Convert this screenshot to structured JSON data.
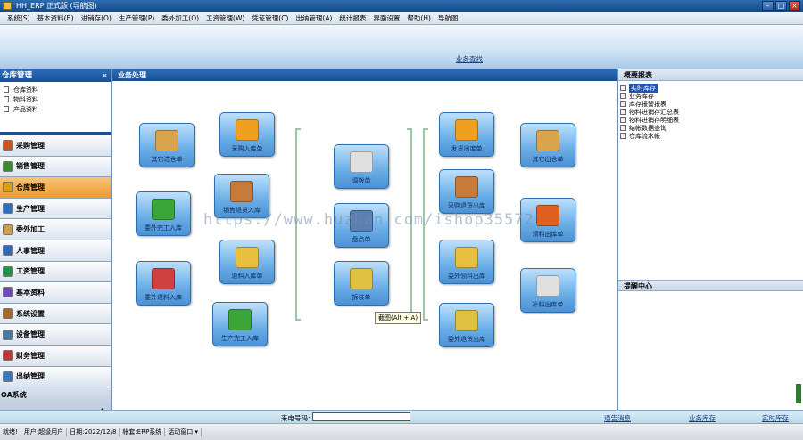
{
  "window": {
    "title": "HH_ERP  正式版  (导航图)",
    "min": "–",
    "max": "□",
    "close": "×"
  },
  "menu": [
    "系统(S)",
    "基本资料(B)",
    "进销存(O)",
    "生产管理(P)",
    "委外加工(O)",
    "工资管理(W)",
    "凭证管理(C)",
    "出纳管理(A)",
    "统计报表",
    "界面设置",
    "帮助(H)",
    "导航图"
  ],
  "banner": {
    "tab": "业务查找"
  },
  "left": {
    "header": "仓库管理",
    "collapse": "«",
    "subitems": [
      "仓库资料",
      "物料资料",
      "产品资料"
    ],
    "nav": [
      {
        "label": "采购管理",
        "color": "#c8551e"
      },
      {
        "label": "销售管理",
        "color": "#3a8a2e"
      },
      {
        "label": "仓库管理",
        "color": "#d4a017"
      },
      {
        "label": "生产管理",
        "color": "#2f6fc0"
      },
      {
        "label": "委外加工",
        "color": "#c7a24a"
      },
      {
        "label": "人事管理",
        "color": "#3467b5"
      },
      {
        "label": "工资管理",
        "color": "#2a8f4e"
      },
      {
        "label": "基本资料",
        "color": "#6b4fb0"
      },
      {
        "label": "系统设置",
        "color": "#a06a2a"
      },
      {
        "label": "设备管理",
        "color": "#4a7b9d"
      },
      {
        "label": "财务管理",
        "color": "#b83a3a"
      },
      {
        "label": "出纳管理",
        "color": "#3b78b8"
      }
    ],
    "active": "仓库管理",
    "oa": "OA系统",
    "scroll": "⇟"
  },
  "center": {
    "header": "业务处理",
    "tiles": [
      {
        "label": "其它进仓单",
        "color": "#d9a44a"
      },
      {
        "label": "采购入库单",
        "color": "#f0a020"
      },
      {
        "label": "委外完工入库",
        "color": "#3aa63a"
      },
      {
        "label": "销售退货入库",
        "color": "#c87a3a"
      },
      {
        "label": "委外退料入库",
        "color": "#d04040"
      },
      {
        "label": "退料入库单",
        "color": "#e8c040"
      },
      {
        "label": "生产完工入库",
        "color": "#3aa63a"
      },
      {
        "label": "调拨单",
        "color": "#e0e0e0"
      },
      {
        "label": "盘点单",
        "color": "#5a7fb0"
      },
      {
        "label": "拆装单",
        "color": "#e0c040"
      },
      {
        "label": "发货出库单",
        "color": "#f0a020"
      },
      {
        "label": "采购退货出库",
        "color": "#c87a3a"
      },
      {
        "label": "委外领料出库",
        "color": "#e8c040"
      },
      {
        "label": "委外退货出库",
        "color": "#e0c040"
      },
      {
        "label": "其它出仓单",
        "color": "#d9a44a"
      },
      {
        "label": "领料出库单",
        "color": "#e06020"
      },
      {
        "label": "补料出库单",
        "color": "#e0e0e0"
      }
    ],
    "tooltip": "截图(Alt + A)",
    "watermark": "https://www.huzhan.com/ishop35572"
  },
  "right": {
    "header": "概要报表",
    "reports": [
      "实时库存",
      "业务库存",
      "库存报警报表",
      "物料进销存汇总表",
      "物料进销存明细表",
      "结帐数据查询",
      "仓库流水帐"
    ],
    "selected": "实时库存",
    "remind": "提醒中心"
  },
  "bottom": {
    "phone_label": "来电号码:",
    "phone_value": "",
    "links": [
      "通告消息",
      "业务库存",
      "实时库存"
    ]
  },
  "status": {
    "ready": "就绪!",
    "user": "用户:超级用户",
    "date": "日期:2022/12/8",
    "account": "帐套:ERP系统",
    "window": "活动窗口 ▾"
  }
}
